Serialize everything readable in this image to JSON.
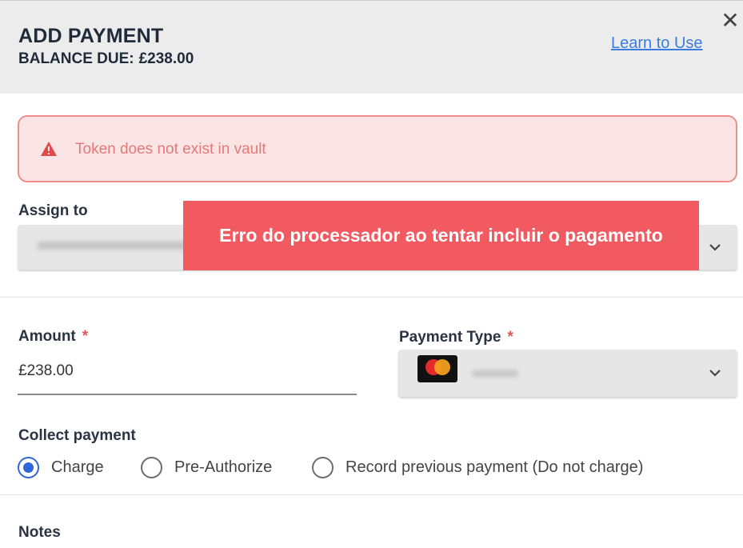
{
  "header": {
    "title": "ADD PAYMENT",
    "balance_label": "BALANCE DUE:",
    "balance_amount": "£238.00",
    "learn_link": "Learn to Use",
    "close_glyph": "✕"
  },
  "alert": {
    "message": "Token does not exist in vault",
    "icon": "warning-icon"
  },
  "tooltip": {
    "text": "Erro do processador ao tentar incluir o pagamento"
  },
  "assign": {
    "label": "Assign to"
  },
  "amount": {
    "label": "Amount",
    "required_mark": "*",
    "value": "£238.00"
  },
  "payment_type": {
    "label": "Payment Type",
    "required_mark": "*",
    "card_icon": "mastercard-icon"
  },
  "collect": {
    "label": "Collect payment",
    "options": [
      {
        "label": "Charge",
        "checked": true
      },
      {
        "label": "Pre-Authorize",
        "checked": false
      },
      {
        "label": "Record previous payment (Do not charge)",
        "checked": false
      }
    ]
  },
  "notes": {
    "label": "Notes"
  },
  "colors": {
    "alert_bg": "#fbe4e4",
    "alert_border": "#ef8d8d",
    "tooltip_bg": "#f05a60",
    "link": "#3a7de0",
    "radio_active": "#2f66d8"
  }
}
